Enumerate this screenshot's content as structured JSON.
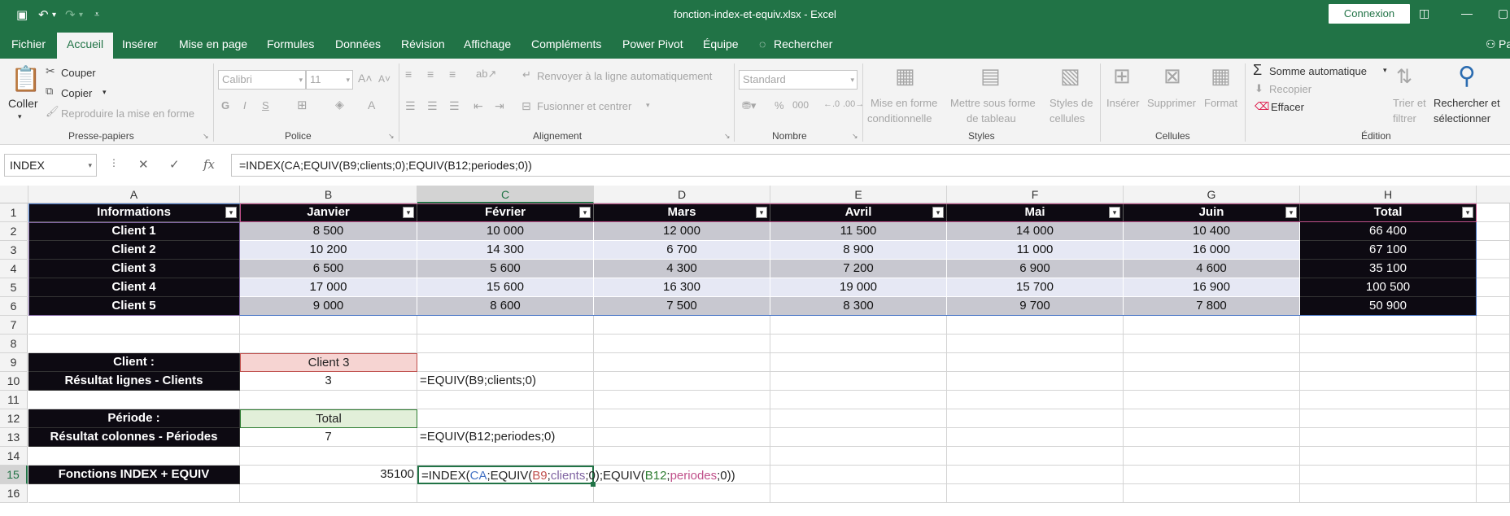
{
  "titlebar": {
    "title": "fonction-index-et-equiv.xlsx  -  Excel",
    "signin": "Connexion",
    "user_initials": "Pa"
  },
  "tabs": [
    "Fichier",
    "Accueil",
    "Insérer",
    "Mise en page",
    "Formules",
    "Données",
    "Révision",
    "Affichage",
    "Compléments",
    "Power Pivot",
    "Équipe",
    "Rechercher"
  ],
  "ribbon": {
    "clipboard": {
      "paste": "Coller",
      "cut": "Couper",
      "copy": "Copier",
      "format_painter": "Reproduire la mise en forme",
      "group": "Presse-papiers"
    },
    "font": {
      "font_name": "Calibri",
      "font_size": "11",
      "group": "Police"
    },
    "alignment": {
      "wrap": "Renvoyer à la ligne automatiquement",
      "merge": "Fusionner et centrer",
      "group": "Alignement"
    },
    "number": {
      "format": "Standard",
      "group": "Nombre"
    },
    "styles": {
      "conditional": "Mise en forme",
      "conditional2": "conditionnelle",
      "table": "Mettre sous forme",
      "table2": "de tableau",
      "cell": "Styles de",
      "cell2": "cellules",
      "group": "Styles"
    },
    "cells": {
      "insert": "Insérer",
      "delete": "Supprimer",
      "format": "Format",
      "group": "Cellules"
    },
    "editing": {
      "autosum": "Somme automatique",
      "fill": "Recopier",
      "clear": "Effacer",
      "sort": "Trier et",
      "sort2": "filtrer",
      "find": "Rechercher et",
      "find2": "sélectionner",
      "group": "Édition"
    }
  },
  "formula_bar": {
    "name_box": "INDEX",
    "formula": "=INDEX(CA;EQUIV(B9;clients;0);EQUIV(B12;periodes;0))"
  },
  "columns": [
    "A",
    "B",
    "C",
    "D",
    "E",
    "F",
    "G",
    "H"
  ],
  "rows": [
    "1",
    "2",
    "3",
    "4",
    "5",
    "6",
    "7",
    "8",
    "9",
    "10",
    "11",
    "12",
    "13",
    "14",
    "15",
    "16"
  ],
  "table": {
    "headers": [
      "Informations",
      "Janvier",
      "Février",
      "Mars",
      "Avril",
      "Mai",
      "Juin",
      "Total"
    ],
    "data": [
      [
        "Client 1",
        "8 500",
        "10 000",
        "12 000",
        "11 500",
        "14 000",
        "10 400",
        "66 400"
      ],
      [
        "Client 2",
        "10 200",
        "14 300",
        "6 700",
        "8 900",
        "11 000",
        "16 000",
        "67 100"
      ],
      [
        "Client 3",
        "6 500",
        "5 600",
        "4 300",
        "7 200",
        "6 900",
        "4 600",
        "35 100"
      ],
      [
        "Client 4",
        "17 000",
        "15 600",
        "16 300",
        "19 000",
        "15 700",
        "16 900",
        "100 500"
      ],
      [
        "Client 5",
        "9 000",
        "8 600",
        "7 500",
        "8 300",
        "9 700",
        "7 800",
        "50 900"
      ]
    ]
  },
  "lookup": {
    "client_label": "Client :",
    "client_value": "Client 3",
    "row_label": "Résultat lignes - Clients",
    "row_value": "3",
    "row_formula": "=EQUIV(B9;clients;0)",
    "period_label": "Période :",
    "period_value": "Total",
    "col_label": "Résultat colonnes - Périodes",
    "col_value": "7",
    "col_formula": "=EQUIV(B12;periodes;0)",
    "index_label": "Fonctions INDEX + EQUIV",
    "index_value": "35100",
    "f_parts": [
      "=INDEX(",
      "CA",
      ";EQUIV(",
      "B9",
      ";",
      "clients",
      ";0)",
      ";EQUIV(",
      "B12",
      ";",
      "periodes",
      ";0))"
    ]
  },
  "colors": {
    "ribbon_green": "#217346",
    "table_dark": "#0d0a12",
    "band_a": "#c8c8d0",
    "band_b": "#e6e8f4",
    "ref_blue": "#4472c4",
    "ref_red": "#c0504d",
    "ref_purple": "#8064a2",
    "ref_green": "#2e7d32"
  }
}
